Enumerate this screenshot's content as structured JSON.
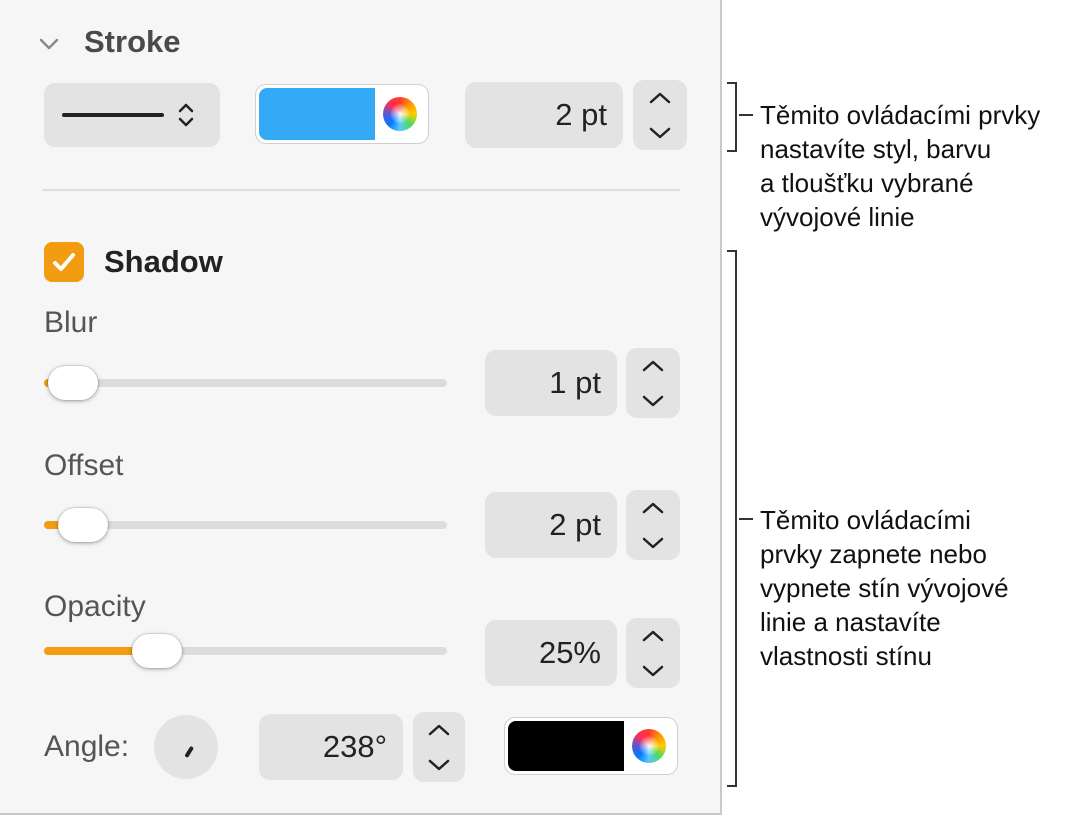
{
  "stroke": {
    "title": "Stroke",
    "line_style": "solid",
    "color": "#34aaf6",
    "width": "2 pt"
  },
  "shadow": {
    "title": "Shadow",
    "enabled": true,
    "blur": {
      "label": "Blur",
      "value": "1 pt",
      "level": 0.05
    },
    "offset": {
      "label": "Offset",
      "value": "2 pt",
      "level": 0.09
    },
    "opacity": {
      "label": "Opacity",
      "value": "25%",
      "level": 0.25
    },
    "angle": {
      "label": "Angle:",
      "value": "238°",
      "degrees": 238
    },
    "color": "#000000"
  },
  "accent_color": "#f39c12",
  "annotations": {
    "stroke_lines": [
      "Těmito ovládacími prvky",
      "nastavíte styl, barvu",
      "a tloušťku vybrané",
      "vývojové linie"
    ],
    "shadow_lines": [
      "Těmito ovládacími",
      "prvky zapnete nebo",
      "vypnete stín vývojové",
      "linie a nastavíte",
      "vlastnosti stínu"
    ]
  }
}
